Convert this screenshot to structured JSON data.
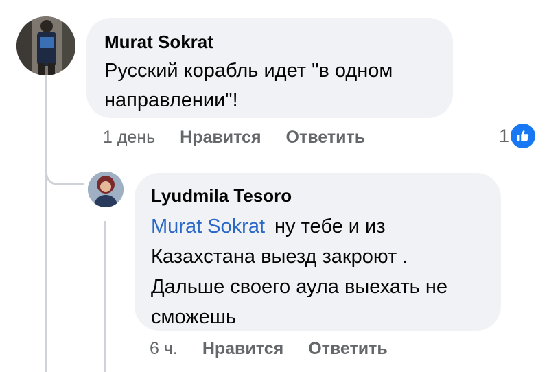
{
  "comment": {
    "author": "Murat Sokrat",
    "text_line1": "Русский корабль идет \"в одном",
    "text_line2": "направлении\"!",
    "time": "1 день",
    "like_label": "Нравится",
    "reply_label": "Ответить",
    "reaction_count": "1",
    "reaction_icon": "like-icon",
    "accent_color": "#1877f2"
  },
  "reply": {
    "author": "Lyudmila Tesoro",
    "mention": "Murat Sokrat",
    "text_line1": "ну тебе и из",
    "text_line2": "Казахстана выезд закроют .",
    "text_line3": "Дальше своего аула выехать не",
    "text_line4": "сможешь",
    "time": "6 ч.",
    "like_label": "Нравится",
    "reply_label": "Ответить",
    "mention_color": "#2a68c8"
  }
}
